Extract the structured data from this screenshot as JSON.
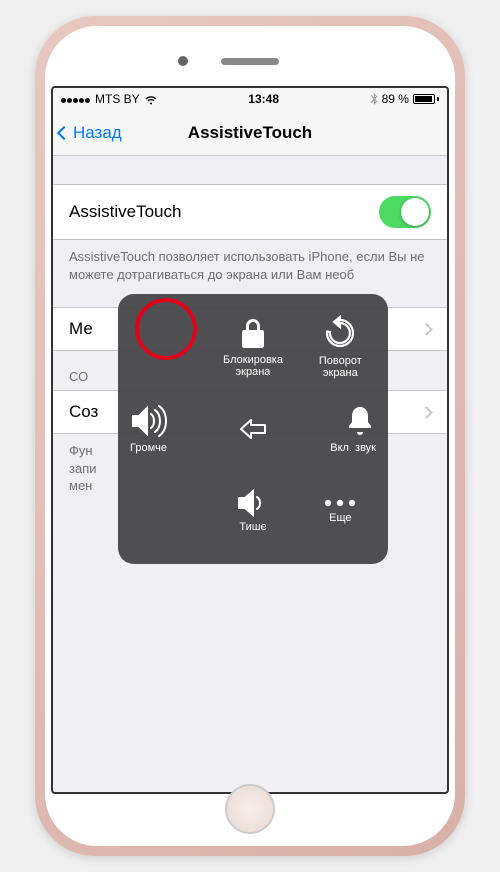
{
  "statusbar": {
    "carrier": "MTS BY",
    "time": "13:48",
    "battery_pct": "89 %"
  },
  "navbar": {
    "back": "Назад",
    "title": "AssistiveTouch"
  },
  "toggle_row": {
    "label": "AssistiveTouch"
  },
  "description": "AssistiveTouch позволяет использовать iPhone, если Вы не можете дотрагиваться до экрана или Вам необ",
  "menu_row": "Ме",
  "section_header": "СО",
  "create_row": "Соз",
  "bottom_desc": "Фун\nзапи\nмен",
  "at_menu": {
    "lock": "Блокировка\nэкрана",
    "rotate": "Поворот\nэкрана",
    "louder": "Громче",
    "sound_on": "Вкл. звук",
    "quieter": "Тише",
    "more": "Еще"
  }
}
